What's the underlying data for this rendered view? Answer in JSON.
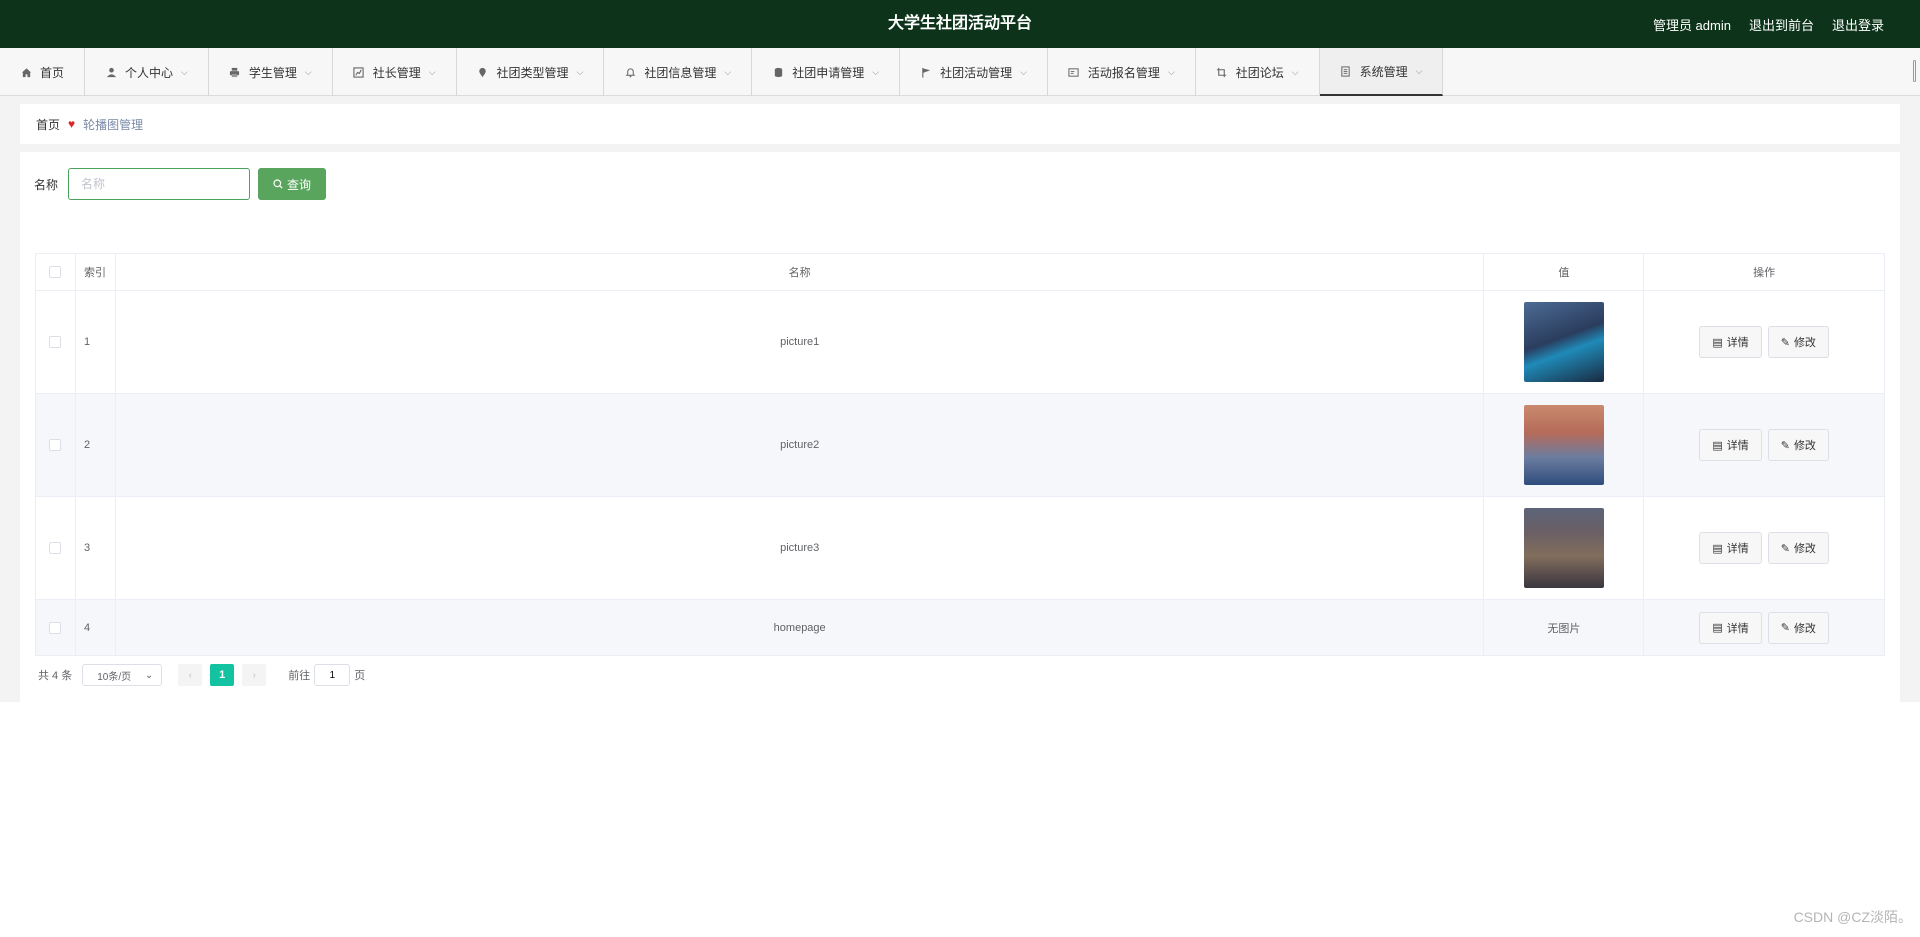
{
  "header": {
    "title": "大学生社团活动平台",
    "user_label": "管理员 admin",
    "back_to_front": "退出到前台",
    "logout": "退出登录",
    "bg_color": "#0d341a"
  },
  "nav": {
    "items": [
      {
        "label": "首页",
        "icon": "home-icon",
        "dropdown": false
      },
      {
        "label": "个人中心",
        "icon": "user-icon",
        "dropdown": true
      },
      {
        "label": "学生管理",
        "icon": "printer-icon",
        "dropdown": true
      },
      {
        "label": "社长管理",
        "icon": "chart-icon",
        "dropdown": true
      },
      {
        "label": "社团类型管理",
        "icon": "location-icon",
        "dropdown": true
      },
      {
        "label": "社团信息管理",
        "icon": "bell-icon",
        "dropdown": true
      },
      {
        "label": "社团申请管理",
        "icon": "database-icon",
        "dropdown": true
      },
      {
        "label": "社团活动管理",
        "icon": "flag-icon",
        "dropdown": true
      },
      {
        "label": "活动报名管理",
        "icon": "postcard-icon",
        "dropdown": true
      },
      {
        "label": "社团论坛",
        "icon": "crop-icon",
        "dropdown": true
      },
      {
        "label": "系统管理",
        "icon": "document-icon",
        "dropdown": true
      }
    ]
  },
  "breadcrumb": {
    "home": "首页",
    "current": "轮播图管理"
  },
  "search": {
    "label": "名称",
    "placeholder": "名称",
    "button_label": "查询",
    "button_color": "#5aa55d"
  },
  "table": {
    "headers": {
      "index": "索引",
      "name": "名称",
      "value": "值",
      "ops": "操作"
    },
    "rows": [
      {
        "index": "1",
        "name": "picture1",
        "value": "",
        "has_image": true
      },
      {
        "index": "2",
        "name": "picture2",
        "value": "",
        "has_image": true
      },
      {
        "index": "3",
        "name": "picture3",
        "value": "",
        "has_image": true
      },
      {
        "index": "4",
        "name": "homepage",
        "value": "无图片",
        "has_image": false
      }
    ],
    "detail_label": "详情",
    "edit_label": "修改"
  },
  "pagination": {
    "total": "共 4 条",
    "page_size": "10条/页",
    "current_page": "1",
    "goto_prefix": "前往",
    "goto_value": "1",
    "goto_suffix": "页",
    "active_color": "#13c2a1"
  },
  "watermark": "CSDN @CZ淡陌。"
}
